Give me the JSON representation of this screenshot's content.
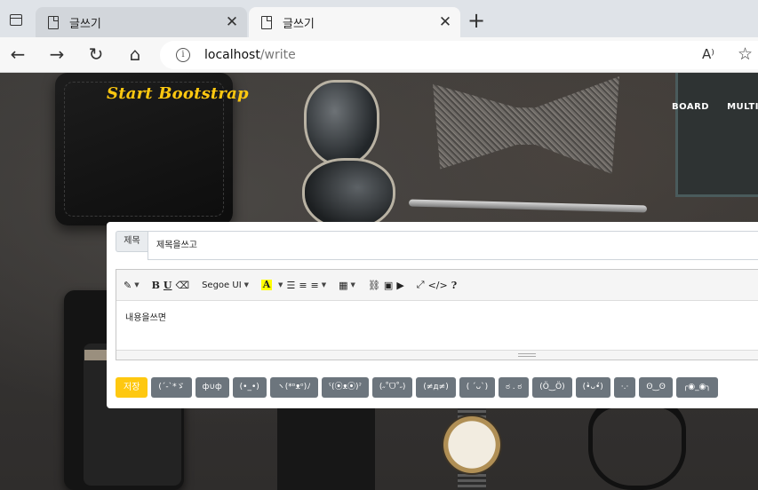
{
  "browser": {
    "tabs": [
      {
        "title": "글쓰기",
        "active": false
      },
      {
        "title": "글쓰기",
        "active": true
      }
    ],
    "new_tab_glyph": "+",
    "url_host": "localhost",
    "url_path": "/write",
    "icons": {
      "back": "←",
      "forward": "→",
      "refresh": "↻",
      "home": "⌂",
      "info": "i",
      "read_aloud": "A⁾",
      "favorite": "☆",
      "close": "✕"
    }
  },
  "page": {
    "brand": "Start Bootstrap",
    "nav": [
      "BOARD",
      "MULTI BOARD"
    ],
    "form": {
      "title_label": "제목",
      "title_value": "제목을쓰고",
      "content_value": "내용을쓰면"
    },
    "toolbar": {
      "style_glyph": "✎",
      "bold": "B",
      "underline": "U",
      "eraser": "⌫",
      "font": "Segoe UI",
      "highlight": "A",
      "ul": "☰",
      "ol": "≡",
      "align": "≡",
      "table": "▦",
      "link": "⛓",
      "image": "▣",
      "video": "▶",
      "fullscreen": "⤢",
      "code": "</>",
      "help": "?"
    },
    "buttons": {
      "save": "저장",
      "emoticons": [
        "(´-`*ゞ",
        "ф∪ф",
        "(•_•)",
        "ヽ(*ᵒᴥᵒ)ﾉ",
        "ˁ(⦿ᴥ⦿)ˀ",
        "(˶˚ᗜ˚˶)",
        "(≠д≠)",
        "( ´ᴗ`)",
        "ಠ . ಠ",
        "(Ö‿Ö)",
        "(•̀ᴗ•́)",
        "·.·",
        "ʘ‿ʘ",
        "╭◉_◉╮"
      ]
    }
  },
  "colors": {
    "accent": "#fec810",
    "secondary": "#6c757d"
  }
}
